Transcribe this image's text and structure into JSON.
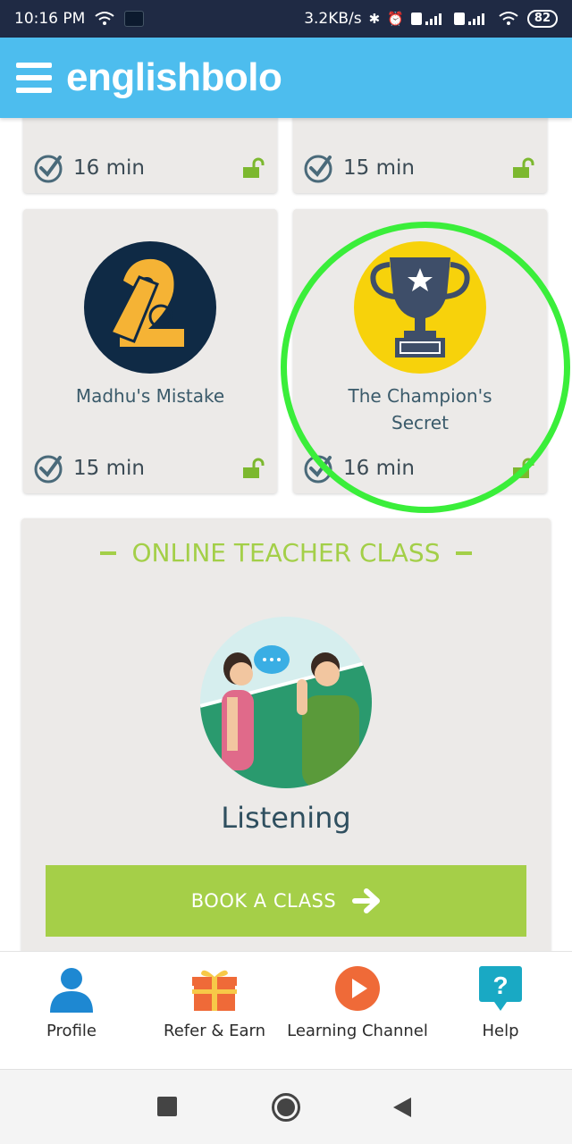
{
  "status_bar": {
    "time": "10:16 PM",
    "network_speed": "3.2KB/s",
    "battery": "82",
    "icons": [
      "wifi-icon",
      "bluetooth-icon",
      "alarm-icon",
      "volte-icon",
      "signal-icon",
      "wifi-icon"
    ]
  },
  "app_bar": {
    "brand": "englishbolo",
    "menu_icon": "hamburger-menu-icon"
  },
  "lessons": [
    {
      "title": "",
      "duration": "16 min",
      "unlocked": true
    },
    {
      "title": "",
      "duration": "15 min",
      "unlocked": true
    },
    {
      "title": "Madhu's Mistake",
      "duration": "15 min",
      "unlocked": true,
      "icon": "number-two-icon"
    },
    {
      "title": "The Champion's Secret",
      "duration": "16 min",
      "unlocked": true,
      "icon": "trophy-icon"
    }
  ],
  "online_class": {
    "heading": "ONLINE TEACHER CLASS",
    "name": "Listening",
    "button_label": "BOOK A CLASS",
    "button_icon": "arrow-right-icon"
  },
  "bottom_nav": [
    {
      "label": "Profile",
      "icon": "profile-icon"
    },
    {
      "label": "Refer & Earn",
      "icon": "gift-icon"
    },
    {
      "label": "Learning Channel",
      "icon": "play-icon"
    },
    {
      "label": "Help",
      "icon": "help-icon"
    }
  ],
  "colors": {
    "status_bar": "#1f2a44",
    "app_bar": "#4dbdee",
    "accent_green": "#a5cf48",
    "highlight_ring": "#3aee3a",
    "card_bg": "#eceae8"
  }
}
